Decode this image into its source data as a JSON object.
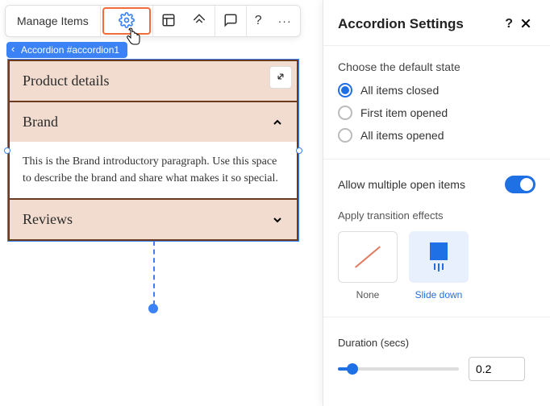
{
  "toolbar": {
    "manage_label": "Manage Items"
  },
  "breadcrumb": {
    "label": "Accordion #accordion1"
  },
  "accordion": {
    "items": [
      {
        "title": "Product details"
      },
      {
        "title": "Brand",
        "body": "This is the Brand introductory paragraph. Use this space to describe the brand and share what makes it so special."
      },
      {
        "title": "Reviews"
      }
    ]
  },
  "panel": {
    "title": "Accordion Settings",
    "default_state": {
      "label": "Choose the default state",
      "options": [
        {
          "label": "All items closed",
          "checked": true
        },
        {
          "label": "First item opened",
          "checked": false
        },
        {
          "label": "All items opened",
          "checked": false
        }
      ]
    },
    "allow_multiple": {
      "label": "Allow multiple open items",
      "value": true
    },
    "transition": {
      "label": "Apply transition effects",
      "options": [
        {
          "label": "None",
          "selected": false
        },
        {
          "label": "Slide down",
          "selected": true
        }
      ]
    },
    "duration": {
      "label": "Duration (secs)",
      "value": "0.2"
    }
  },
  "icons": {
    "gear": "gear-icon",
    "layout": "layout-icon",
    "animation": "animation-icon",
    "comment": "comment-icon",
    "help": "help-icon",
    "more": "more-icon",
    "close": "close-icon",
    "expand": "expand-icon"
  }
}
